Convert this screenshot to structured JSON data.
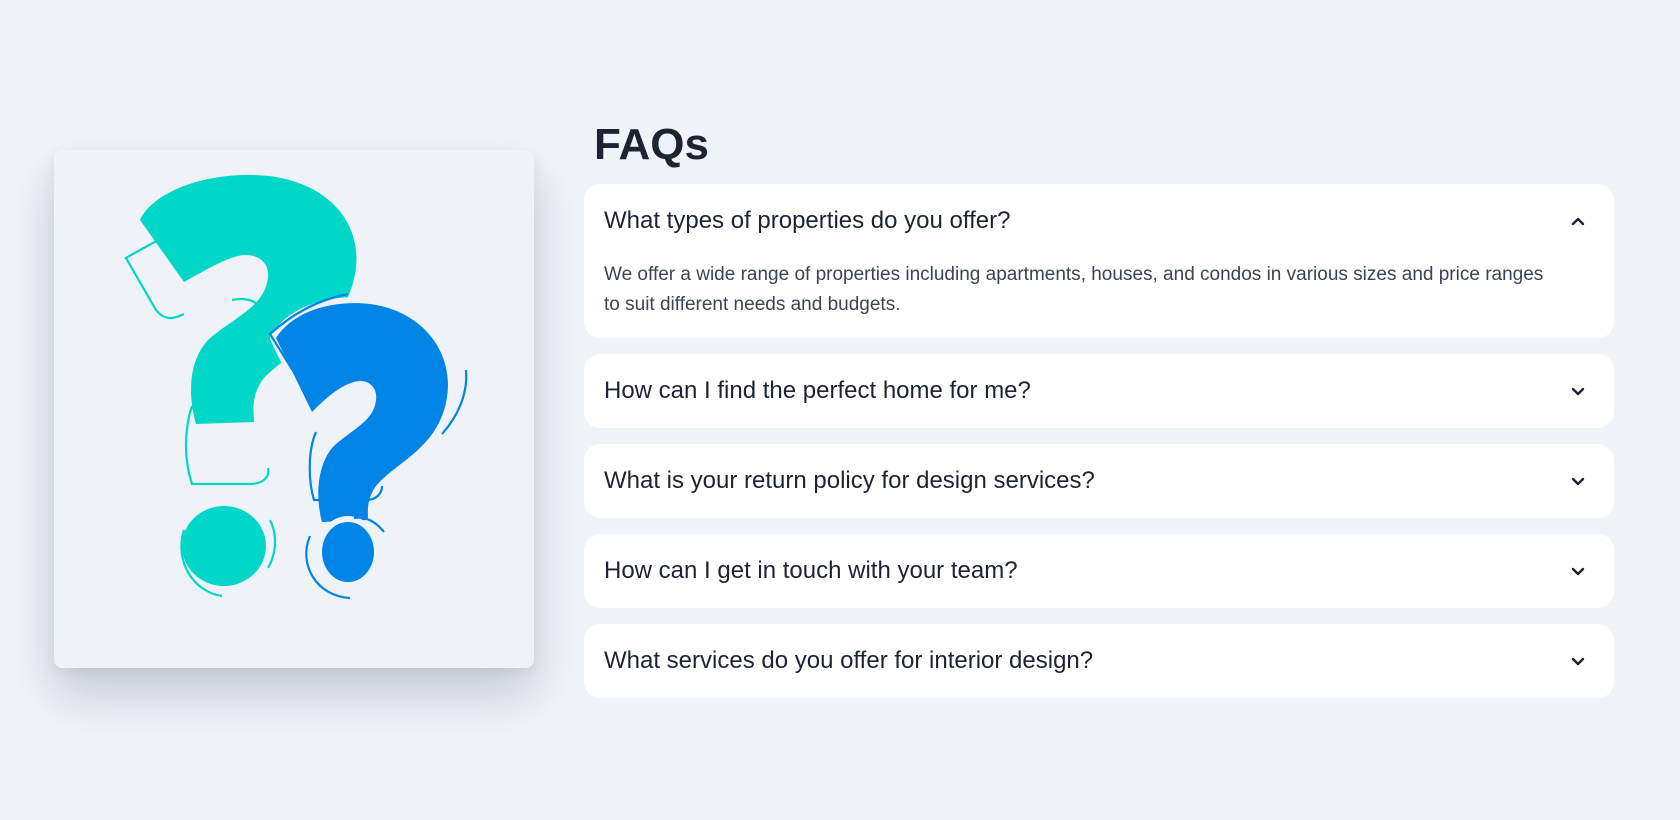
{
  "illustration": {
    "icon": "question-marks-illustration",
    "colors": {
      "primary_mark": "#00d7c9",
      "secondary_mark": "#0085e6",
      "background": "#eff3f8"
    }
  },
  "faq": {
    "title": "FAQs",
    "items": [
      {
        "question": "What types of properties do you offer?",
        "answer": "We offer a wide range of properties including apartments, houses, and condos in various sizes and price ranges to suit different needs and budgets.",
        "expanded": true,
        "icon": "chevron-up-icon"
      },
      {
        "question": "How can I find the perfect home for me?",
        "expanded": false,
        "icon": "chevron-down-icon"
      },
      {
        "question": "What is your return policy for design services?",
        "expanded": false,
        "icon": "chevron-down-icon"
      },
      {
        "question": "How can I get in touch with your team?",
        "expanded": false,
        "icon": "chevron-down-icon"
      },
      {
        "question": "What services do you offer for interior design?",
        "expanded": false,
        "icon": "chevron-down-icon"
      }
    ]
  },
  "colors": {
    "page_background": "#f0f3f8",
    "card_background": "#ffffff",
    "text_primary": "#1c2434",
    "text_secondary": "#3b4457"
  }
}
